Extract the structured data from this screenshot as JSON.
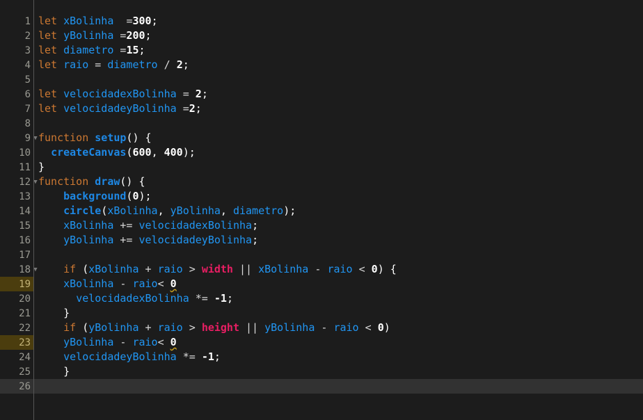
{
  "editor": {
    "theme_name": "dark",
    "colors": {
      "background": "#1c1c1c",
      "gutter_text": "#9b9b93",
      "active_line_background": "#323232",
      "warning_line_background": "#4b3d0e",
      "keyword": "#cc7832",
      "identifier": "#2196f3",
      "function": "#1e88e5",
      "number": "#ffffff",
      "global_constant": "#e91e63",
      "operator": "#d8d8d8",
      "divider": "#555555",
      "squiggly_warning": "#c8a020"
    },
    "fold_icon": "▼",
    "language": "javascript",
    "total_lines": 26,
    "active_line": 26,
    "warning_lines": [
      19,
      23
    ]
  },
  "lines": [
    {
      "number": "1",
      "fold": false,
      "state": "normal",
      "tokens": [
        {
          "t": "let",
          "c": "kw"
        },
        {
          "t": " ",
          "c": "plain"
        },
        {
          "t": "xBolinha",
          "c": "id"
        },
        {
          "t": "  ",
          "c": "plain"
        },
        {
          "t": "=",
          "c": "op"
        },
        {
          "t": "300",
          "c": "num"
        },
        {
          "t": ";",
          "c": "punc"
        }
      ]
    },
    {
      "number": "2",
      "fold": false,
      "state": "normal",
      "tokens": [
        {
          "t": "let",
          "c": "kw"
        },
        {
          "t": " ",
          "c": "plain"
        },
        {
          "t": "yBolinha",
          "c": "id"
        },
        {
          "t": " ",
          "c": "plain"
        },
        {
          "t": "=",
          "c": "op"
        },
        {
          "t": "200",
          "c": "num"
        },
        {
          "t": ";",
          "c": "punc"
        }
      ]
    },
    {
      "number": "3",
      "fold": false,
      "state": "normal",
      "tokens": [
        {
          "t": "let",
          "c": "kw"
        },
        {
          "t": " ",
          "c": "plain"
        },
        {
          "t": "diametro",
          "c": "id"
        },
        {
          "t": " ",
          "c": "plain"
        },
        {
          "t": "=",
          "c": "op"
        },
        {
          "t": "15",
          "c": "num"
        },
        {
          "t": ";",
          "c": "punc"
        }
      ]
    },
    {
      "number": "4",
      "fold": false,
      "state": "normal",
      "tokens": [
        {
          "t": "let",
          "c": "kw"
        },
        {
          "t": " ",
          "c": "plain"
        },
        {
          "t": "raio",
          "c": "id"
        },
        {
          "t": " ",
          "c": "plain"
        },
        {
          "t": "=",
          "c": "op"
        },
        {
          "t": " ",
          "c": "plain"
        },
        {
          "t": "diametro",
          "c": "id"
        },
        {
          "t": " ",
          "c": "plain"
        },
        {
          "t": "/",
          "c": "op"
        },
        {
          "t": " ",
          "c": "plain"
        },
        {
          "t": "2",
          "c": "num"
        },
        {
          "t": ";",
          "c": "punc"
        }
      ]
    },
    {
      "number": "5",
      "fold": false,
      "state": "normal",
      "tokens": []
    },
    {
      "number": "6",
      "fold": false,
      "state": "normal",
      "tokens": [
        {
          "t": "let",
          "c": "kw"
        },
        {
          "t": " ",
          "c": "plain"
        },
        {
          "t": "velocidadexBolinha",
          "c": "id"
        },
        {
          "t": " ",
          "c": "plain"
        },
        {
          "t": "=",
          "c": "op"
        },
        {
          "t": " ",
          "c": "plain"
        },
        {
          "t": "2",
          "c": "num"
        },
        {
          "t": ";",
          "c": "punc"
        }
      ]
    },
    {
      "number": "7",
      "fold": false,
      "state": "normal",
      "tokens": [
        {
          "t": "let",
          "c": "kw"
        },
        {
          "t": " ",
          "c": "plain"
        },
        {
          "t": "velocidadeyBolinha",
          "c": "id"
        },
        {
          "t": " ",
          "c": "plain"
        },
        {
          "t": "=",
          "c": "op"
        },
        {
          "t": "2",
          "c": "num"
        },
        {
          "t": ";",
          "c": "punc"
        }
      ]
    },
    {
      "number": "8",
      "fold": false,
      "state": "normal",
      "tokens": []
    },
    {
      "number": "9",
      "fold": true,
      "state": "normal",
      "tokens": [
        {
          "t": "function",
          "c": "kw"
        },
        {
          "t": " ",
          "c": "plain"
        },
        {
          "t": "setup",
          "c": "fn"
        },
        {
          "t": "() {",
          "c": "punc"
        }
      ]
    },
    {
      "number": "10",
      "fold": false,
      "state": "normal",
      "tokens": [
        {
          "t": "  ",
          "c": "plain"
        },
        {
          "t": "createCanvas",
          "c": "fn"
        },
        {
          "t": "(",
          "c": "punc"
        },
        {
          "t": "600",
          "c": "num"
        },
        {
          "t": ", ",
          "c": "punc"
        },
        {
          "t": "400",
          "c": "num"
        },
        {
          "t": ");",
          "c": "punc"
        }
      ]
    },
    {
      "number": "11",
      "fold": false,
      "state": "normal",
      "tokens": [
        {
          "t": "}",
          "c": "punc"
        }
      ]
    },
    {
      "number": "12",
      "fold": true,
      "state": "normal",
      "tokens": [
        {
          "t": "function",
          "c": "kw"
        },
        {
          "t": " ",
          "c": "plain"
        },
        {
          "t": "draw",
          "c": "fn"
        },
        {
          "t": "() {",
          "c": "punc"
        }
      ]
    },
    {
      "number": "13",
      "fold": false,
      "state": "normal",
      "tokens": [
        {
          "t": "    ",
          "c": "plain"
        },
        {
          "t": "background",
          "c": "fn"
        },
        {
          "t": "(",
          "c": "punc"
        },
        {
          "t": "0",
          "c": "num"
        },
        {
          "t": ");",
          "c": "punc"
        }
      ]
    },
    {
      "number": "14",
      "fold": false,
      "state": "normal",
      "tokens": [
        {
          "t": "    ",
          "c": "plain"
        },
        {
          "t": "circle",
          "c": "fn"
        },
        {
          "t": "(",
          "c": "punc"
        },
        {
          "t": "xBolinha",
          "c": "id"
        },
        {
          "t": ", ",
          "c": "punc"
        },
        {
          "t": "yBolinha",
          "c": "id"
        },
        {
          "t": ", ",
          "c": "punc"
        },
        {
          "t": "diametro",
          "c": "id"
        },
        {
          "t": ");",
          "c": "punc"
        }
      ]
    },
    {
      "number": "15",
      "fold": false,
      "state": "normal",
      "tokens": [
        {
          "t": "    ",
          "c": "plain"
        },
        {
          "t": "xBolinha",
          "c": "id"
        },
        {
          "t": " ",
          "c": "plain"
        },
        {
          "t": "+=",
          "c": "op"
        },
        {
          "t": " ",
          "c": "plain"
        },
        {
          "t": "velocidadexBolinha",
          "c": "id"
        },
        {
          "t": ";",
          "c": "punc"
        }
      ]
    },
    {
      "number": "16",
      "fold": false,
      "state": "normal",
      "tokens": [
        {
          "t": "    ",
          "c": "plain"
        },
        {
          "t": "yBolinha",
          "c": "id"
        },
        {
          "t": " ",
          "c": "plain"
        },
        {
          "t": "+=",
          "c": "op"
        },
        {
          "t": " ",
          "c": "plain"
        },
        {
          "t": "velocidadeyBolinha",
          "c": "id"
        },
        {
          "t": ";",
          "c": "punc"
        }
      ]
    },
    {
      "number": "17",
      "fold": false,
      "state": "normal",
      "tokens": []
    },
    {
      "number": "18",
      "fold": true,
      "state": "normal",
      "tokens": [
        {
          "t": "    ",
          "c": "plain"
        },
        {
          "t": "if",
          "c": "kw"
        },
        {
          "t": " ",
          "c": "plain"
        },
        {
          "t": "(",
          "c": "punc"
        },
        {
          "t": "xBolinha",
          "c": "id"
        },
        {
          "t": " ",
          "c": "plain"
        },
        {
          "t": "+",
          "c": "op"
        },
        {
          "t": " ",
          "c": "plain"
        },
        {
          "t": "raio",
          "c": "id"
        },
        {
          "t": " ",
          "c": "plain"
        },
        {
          "t": ">",
          "c": "op"
        },
        {
          "t": " ",
          "c": "plain"
        },
        {
          "t": "width",
          "c": "global"
        },
        {
          "t": " ",
          "c": "plain"
        },
        {
          "t": "||",
          "c": "op"
        },
        {
          "t": " ",
          "c": "plain"
        },
        {
          "t": "xBolinha",
          "c": "id"
        },
        {
          "t": " ",
          "c": "plain"
        },
        {
          "t": "-",
          "c": "op"
        },
        {
          "t": " ",
          "c": "plain"
        },
        {
          "t": "raio",
          "c": "id"
        },
        {
          "t": " ",
          "c": "plain"
        },
        {
          "t": "<",
          "c": "op"
        },
        {
          "t": " ",
          "c": "plain"
        },
        {
          "t": "0",
          "c": "num"
        },
        {
          "t": ") {",
          "c": "punc"
        }
      ]
    },
    {
      "number": "19",
      "fold": false,
      "state": "warn",
      "tokens": [
        {
          "t": "    ",
          "c": "plain"
        },
        {
          "t": "xBolinha",
          "c": "id"
        },
        {
          "t": " ",
          "c": "plain"
        },
        {
          "t": "-",
          "c": "op"
        },
        {
          "t": " ",
          "c": "plain"
        },
        {
          "t": "raio",
          "c": "id"
        },
        {
          "t": "<",
          "c": "op"
        },
        {
          "t": " ",
          "c": "plain"
        },
        {
          "t": "0",
          "c": "num",
          "squiggly": true
        }
      ]
    },
    {
      "number": "20",
      "fold": false,
      "state": "normal",
      "tokens": [
        {
          "t": "      ",
          "c": "plain"
        },
        {
          "t": "velocidadexBolinha",
          "c": "id"
        },
        {
          "t": " ",
          "c": "plain"
        },
        {
          "t": "*=",
          "c": "op"
        },
        {
          "t": " ",
          "c": "plain"
        },
        {
          "t": "-1",
          "c": "num"
        },
        {
          "t": ";",
          "c": "punc"
        }
      ]
    },
    {
      "number": "21",
      "fold": false,
      "state": "normal",
      "tokens": [
        {
          "t": "    ",
          "c": "plain"
        },
        {
          "t": "}",
          "c": "punc"
        }
      ]
    },
    {
      "number": "22",
      "fold": false,
      "state": "normal",
      "tokens": [
        {
          "t": "    ",
          "c": "plain"
        },
        {
          "t": "if",
          "c": "kw"
        },
        {
          "t": " ",
          "c": "plain"
        },
        {
          "t": "(",
          "c": "punc"
        },
        {
          "t": "yBolinha",
          "c": "id"
        },
        {
          "t": " ",
          "c": "plain"
        },
        {
          "t": "+",
          "c": "op"
        },
        {
          "t": " ",
          "c": "plain"
        },
        {
          "t": "raio",
          "c": "id"
        },
        {
          "t": " ",
          "c": "plain"
        },
        {
          "t": ">",
          "c": "op"
        },
        {
          "t": " ",
          "c": "plain"
        },
        {
          "t": "height",
          "c": "global"
        },
        {
          "t": " ",
          "c": "plain"
        },
        {
          "t": "||",
          "c": "op"
        },
        {
          "t": " ",
          "c": "plain"
        },
        {
          "t": "yBolinha",
          "c": "id"
        },
        {
          "t": " ",
          "c": "plain"
        },
        {
          "t": "-",
          "c": "op"
        },
        {
          "t": " ",
          "c": "plain"
        },
        {
          "t": "raio",
          "c": "id"
        },
        {
          "t": " ",
          "c": "plain"
        },
        {
          "t": "<",
          "c": "op"
        },
        {
          "t": " ",
          "c": "plain"
        },
        {
          "t": "0",
          "c": "num"
        },
        {
          "t": ")",
          "c": "punc"
        }
      ]
    },
    {
      "number": "23",
      "fold": false,
      "state": "warn",
      "tokens": [
        {
          "t": "    ",
          "c": "plain"
        },
        {
          "t": "yBolinha",
          "c": "id"
        },
        {
          "t": " ",
          "c": "plain"
        },
        {
          "t": "-",
          "c": "op"
        },
        {
          "t": " ",
          "c": "plain"
        },
        {
          "t": "raio",
          "c": "id"
        },
        {
          "t": "<",
          "c": "op"
        },
        {
          "t": " ",
          "c": "plain"
        },
        {
          "t": "0",
          "c": "num",
          "squiggly": true
        }
      ]
    },
    {
      "number": "24",
      "fold": false,
      "state": "normal",
      "tokens": [
        {
          "t": "    ",
          "c": "plain"
        },
        {
          "t": "velocidadeyBolinha",
          "c": "id"
        },
        {
          "t": " ",
          "c": "plain"
        },
        {
          "t": "*=",
          "c": "op"
        },
        {
          "t": " ",
          "c": "plain"
        },
        {
          "t": "-1",
          "c": "num"
        },
        {
          "t": ";",
          "c": "punc"
        }
      ]
    },
    {
      "number": "25",
      "fold": false,
      "state": "normal",
      "tokens": [
        {
          "t": "    ",
          "c": "plain"
        },
        {
          "t": "}",
          "c": "punc"
        }
      ]
    },
    {
      "number": "26",
      "fold": false,
      "state": "active",
      "tokens": []
    }
  ]
}
